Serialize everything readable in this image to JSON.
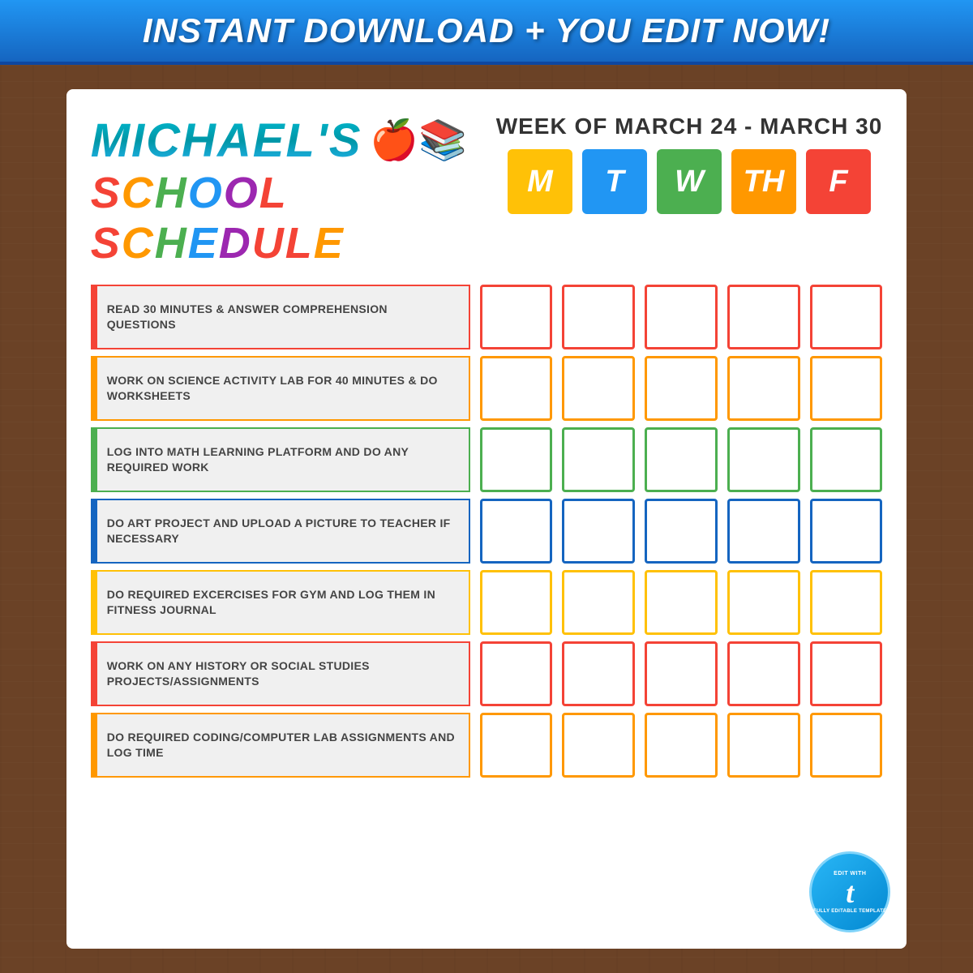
{
  "banner": {
    "text": "INSTANT DOWNLOAD + YOU EDIT NOW!"
  },
  "header": {
    "student_name": "MICHAEL'S",
    "title_line1": "SCHOOL SCHEDULE",
    "week_label": "WEEK OF MARCH 24 - MARCH 30",
    "days": [
      {
        "id": "M",
        "label": "M",
        "color_class": "day-m"
      },
      {
        "id": "T",
        "label": "T",
        "color_class": "day-t"
      },
      {
        "id": "W",
        "label": "W",
        "color_class": "day-w"
      },
      {
        "id": "TH",
        "label": "TH",
        "color_class": "day-th"
      },
      {
        "id": "F",
        "label": "F",
        "color_class": "day-f"
      }
    ]
  },
  "schedule": {
    "rows": [
      {
        "id": "row-1",
        "color": "red",
        "task": "READ 30 MINUTES & ANSWER COMPREHENSION QUESTIONS"
      },
      {
        "id": "row-2",
        "color": "orange",
        "task": "WORK ON SCIENCE ACTIVITY LAB FOR 40 MINUTES & DO WORKSHEETS"
      },
      {
        "id": "row-3",
        "color": "green",
        "task": "LOG INTO MATH LEARNING PLATFORM AND DO ANY REQUIRED WORK"
      },
      {
        "id": "row-4",
        "color": "blue",
        "task": "DO ART PROJECT AND UPLOAD A PICTURE TO TEACHER IF NECESSARY"
      },
      {
        "id": "row-5",
        "color": "yellow",
        "task": "DO REQUIRED EXCERCISES FOR GYM AND LOG THEM IN FITNESS JOURNAL"
      },
      {
        "id": "row-6",
        "color": "red",
        "task": "WORK ON ANY HISTORY OR SOCIAL STUDIES PROJECTS/ASSIGNMENTS"
      },
      {
        "id": "row-7",
        "color": "orange",
        "task": "DO REQUIRED CODING/COMPUTER LAB ASSIGNMENTS AND LOG TIME"
      }
    ]
  },
  "badge": {
    "top_text": "EDIT WITH",
    "brand": "templett",
    "t_letter": "t",
    "bottom_text": "FULLY EDITABLE TEMPLATE"
  }
}
